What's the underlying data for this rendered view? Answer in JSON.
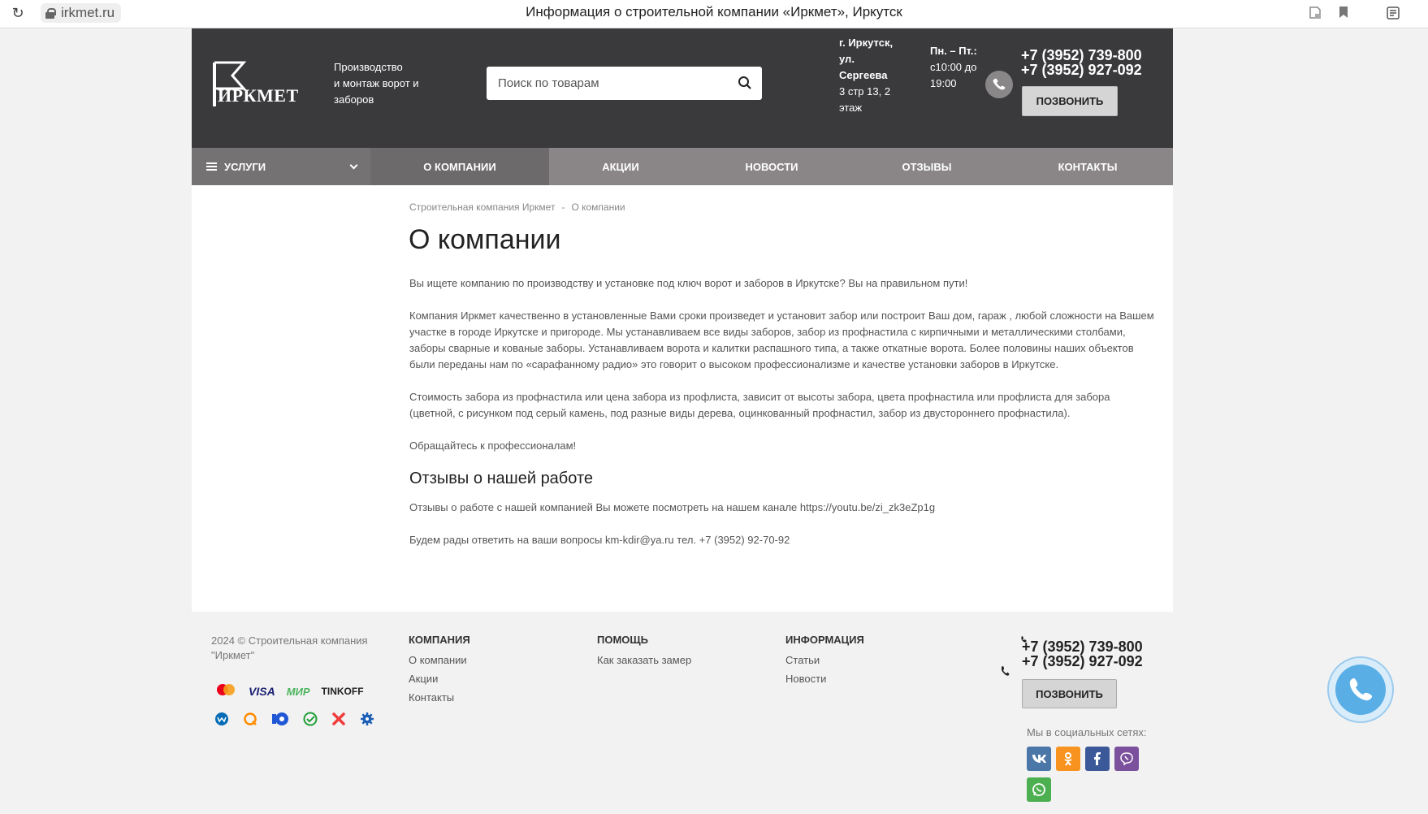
{
  "browser": {
    "url": "irkmet.ru",
    "tab_title": "Информация о строительной компании «Иркмет», Иркутск"
  },
  "header": {
    "logo_text": "ИРКМЕТ",
    "tagline_line1": "Производство",
    "tagline_line2": " и монтаж ворот и заборов",
    "search_placeholder": "Поиск по товарам",
    "address_bold": "г. Иркутск, ул. Сергеева",
    "address_rest": "3 стр 13, 2 этаж",
    "hours_days": "Пн. – Пт.:",
    "hours_time": " с10:00 до 19:00",
    "phone1": "+7 (3952) 739-800",
    "phone2": "+7 (3952) 927-092",
    "call_label": "ПОЗВОНИТЬ"
  },
  "nav": {
    "services": "УСЛУГИ",
    "items": [
      "О КОМПАНИИ",
      "АКЦИИ",
      "НОВОСТИ",
      "ОТЗЫВЫ",
      "КОНТАКТЫ"
    ]
  },
  "main": {
    "breadcrumb": [
      "Строительная компания Иркмет",
      "О компании"
    ],
    "breadcrumb_sep": "-",
    "title": "О компании",
    "p1": "Вы ищете компанию по производству и установке под ключ ворот и заборов в Иркутске? Вы на правильном пути!",
    "p2": "Компания Иркмет качественно в установленные Вами сроки произведет и установит забор или построит Ваш дом, гараж , любой сложности на Вашем участке в городе Иркутске и пригороде. Мы устанавливаем все виды заборов, забор из профнастила с кирпичными и металлическими столбами, заборы сварные и кованые заборы. Устанавливаем ворота и калитки распашного типа, а также откатные ворота. Более половины наших объектов были переданы нам по «сарафанному радио» это говорит о высоком профессионализме и качестве установки заборов в Иркутске.",
    "p3": "Стоимость забора из профнастила или цена забора из профлиста, зависит от высоты забора, цвета профнастила или профлиста для забора (цветной, с рисунком под серый камень, под разные виды дерева, оцинкованный профнастил, забор из двустороннего профнастила).",
    "p4": "Обращайтесь к профессионалам!",
    "h2": "Отзывы о нашей работе",
    "p5": "Отзывы о работе с нашей компанией Вы можете посмотреть на нашем канале https://youtu.be/zi_zk3eZp1g",
    "p6": "Будем рады ответить на ваши вопросы km-kdir@ya.ru тел. +7 (3952) 92-70-92"
  },
  "footer": {
    "copyright": "2024 © Строительная компания \"Иркмет\"",
    "payments": [
      "mastercard-icon",
      "VISA",
      "МИР",
      "TINKOFF",
      "webmoney-icon",
      "qiwi-icon",
      "yoomoney-icon",
      "sberpay-icon",
      "x-pay-icon",
      "settings-pay-icon"
    ],
    "col1": {
      "title": "КОМПАНИЯ",
      "links": [
        "О компании",
        "Акции",
        "Контакты"
      ]
    },
    "col2": {
      "title": "ПОМОЩЬ",
      "links": [
        "Как заказать замер"
      ]
    },
    "col3": {
      "title": "ИНФОРМАЦИЯ",
      "links": [
        "Статьи",
        "Новости"
      ]
    },
    "phone1": "+7 (3952) 739-800",
    "phone2": "+7 (3952) 927-092",
    "call_label": "ПОЗВОНИТЬ",
    "social_title": "Мы в социальных сетях:",
    "social": [
      {
        "name": "vk-icon",
        "label": "vk",
        "color": "#4a76a8"
      },
      {
        "name": "odnoklassniki-icon",
        "label": "ok",
        "color": "#f7931e"
      },
      {
        "name": "facebook-icon",
        "label": "f",
        "color": "#3b5998"
      },
      {
        "name": "viber-icon",
        "label": "viber",
        "color": "#7b519d"
      },
      {
        "name": "whatsapp-icon",
        "label": "wa",
        "color": "#4caf50"
      }
    ]
  }
}
